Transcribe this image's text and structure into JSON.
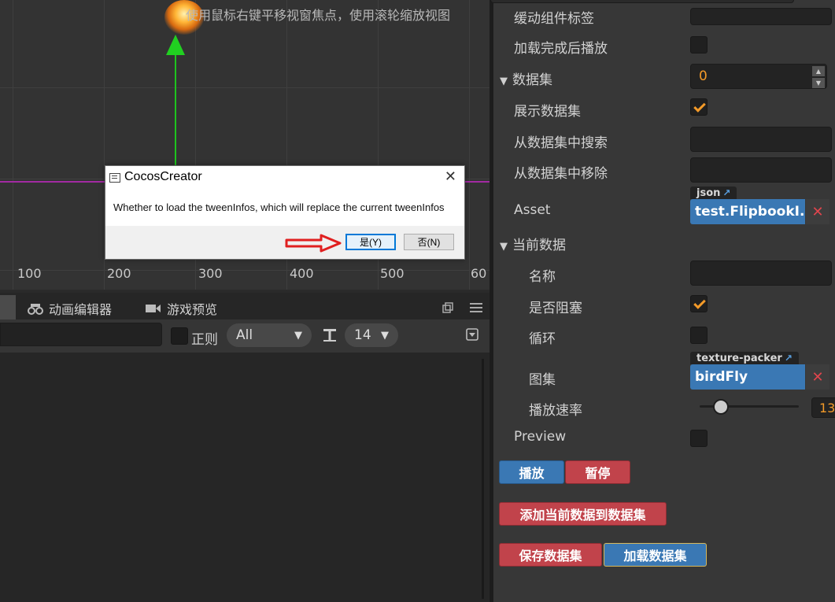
{
  "scene": {
    "hint": "使用鼠标右键平移视窗焦点，使用滚轮缩放视图",
    "ruler_ticks": [
      "100",
      "200",
      "300",
      "400",
      "500",
      "60"
    ]
  },
  "bottom_panel": {
    "tabs": [
      {
        "label": "动画编辑器",
        "icon": "animation-editor-icon"
      },
      {
        "label": "游戏预览",
        "icon": "game-preview-icon"
      }
    ],
    "toolbar": {
      "regex_label": "正则",
      "level_select": "All",
      "font_size": "14"
    }
  },
  "inspector": {
    "rows": {
      "buffer_label": "缓动组件标签",
      "autoplay": "加载完成后播放",
      "dataset": "数据集",
      "dataset_value": "0",
      "show_dataset": "展示数据集",
      "search_dataset": "从数据集中搜索",
      "remove_dataset": "从数据集中移除",
      "asset_label": "Asset",
      "asset_tag": "json",
      "asset_value": "test.FlipbookI...",
      "current_data": "当前数据",
      "name": "名称",
      "blocking": "是否阻塞",
      "loop": "循环",
      "atlas": "图集",
      "atlas_tag": "texture-packer",
      "atlas_value": "birdFly",
      "play_rate": "播放速率",
      "play_rate_value": "13",
      "preview": "Preview"
    },
    "buttons": {
      "play": "播放",
      "pause": "暂停",
      "add_to_dataset": "添加当前数据到数据集",
      "save_dataset": "保存数据集",
      "load_dataset": "加载数据集"
    },
    "checks": {
      "autoplay": false,
      "show_dataset": true,
      "blocking": true,
      "loop": false,
      "preview": false
    }
  },
  "dialog": {
    "title": "CocosCreator",
    "message": "Whether to load the tweenInfos, which will replace the current tweenInfos",
    "yes": "是(Y)",
    "no": "否(N)"
  },
  "colors": {
    "accent_blue": "#3a78b4",
    "accent_red": "#c1434b",
    "check_orange": "#f39a29"
  }
}
